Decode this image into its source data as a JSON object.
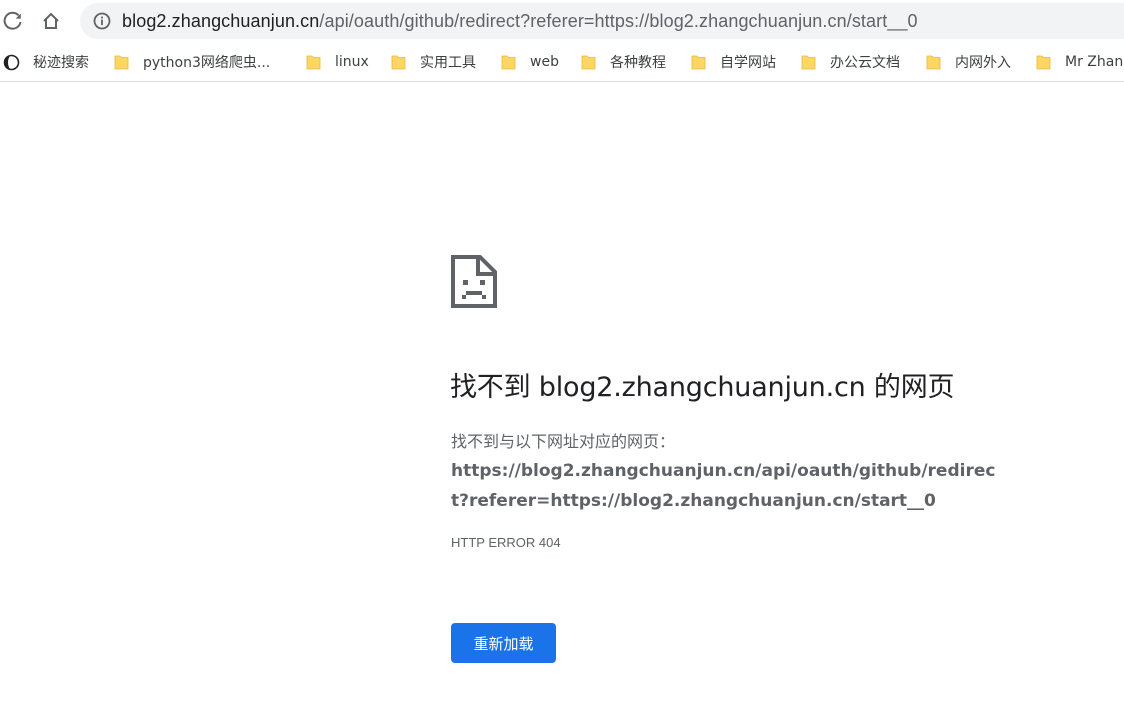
{
  "browser": {
    "url_host": "blog2.zhangchuanjun.cn",
    "url_path": "/api/oauth/github/redirect?referer=https://blog2.zhangchuanjun.cn/start__0",
    "reload_icon": "reload-icon",
    "home_icon": "home-icon",
    "info_icon": "info-icon"
  },
  "bookmarks": [
    {
      "label": "秘迹搜索",
      "icon": "globe-icon"
    },
    {
      "label": "python3网络爬虫...",
      "icon": "folder-icon"
    },
    {
      "label": "linux",
      "icon": "folder-icon"
    },
    {
      "label": "实用工具",
      "icon": "folder-icon"
    },
    {
      "label": "web",
      "icon": "folder-icon"
    },
    {
      "label": "各种教程",
      "icon": "folder-icon"
    },
    {
      "label": "自学网站",
      "icon": "folder-icon"
    },
    {
      "label": "办公云文档",
      "icon": "folder-icon"
    },
    {
      "label": "内网外入",
      "icon": "folder-icon"
    },
    {
      "label": "Mr Zhan",
      "icon": "folder-icon"
    }
  ],
  "error": {
    "title": "找不到 blog2.zhangchuanjun.cn 的网页",
    "intro": "找不到与以下网址对应的网页：",
    "url": "https://blog2.zhangchuanjun.cn/api/oauth/github/redirect?referer=https://blog2.zhangchuanjun.cn/start__0",
    "code": "HTTP ERROR 404",
    "reload_label": "重新加载",
    "icon": "sad-page-icon"
  },
  "colors": {
    "accent": "#1a73e8",
    "folder": "#fdd663",
    "text_secondary": "#5f6368"
  }
}
